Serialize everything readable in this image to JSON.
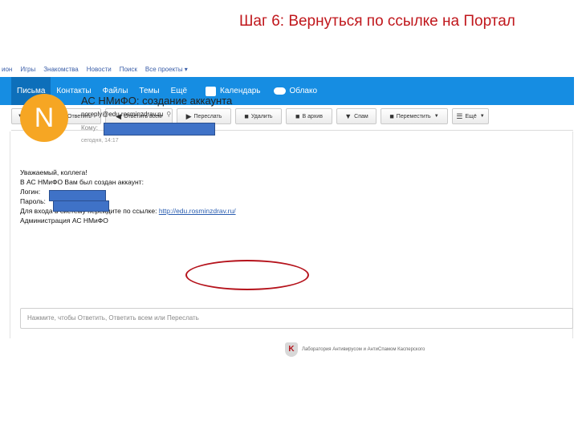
{
  "slide": {
    "title": "Шаг 6: Вернуться по ссылке на Портал"
  },
  "topnav": {
    "items": [
      "ион",
      "Игры",
      "Знакомства",
      "Новости",
      "Поиск",
      "Все проекты ▾"
    ]
  },
  "mainbar": {
    "tabs": [
      "Письма",
      "Контакты",
      "Файлы",
      "Темы",
      "Ещё"
    ],
    "active_tab": "Письма",
    "calendar_label": "Календарь",
    "cloud_label": "Облако",
    "color": "#168de2"
  },
  "toolbar": {
    "reply": "Ответить",
    "reply_all": "Ответить всем",
    "forward": "Переслать",
    "delete": "Удалить",
    "archive": "В архив",
    "spam": "Спам",
    "move": "Переместить",
    "more": "Ещё"
  },
  "message": {
    "avatar_letter": "N",
    "avatar_color": "#f6a623",
    "subject": "АС НМиФО: создание аккаунта",
    "from": "noreply@edu.rosminzdrav.ru",
    "to_label": "Кому:",
    "date": "сегодня, 14:17",
    "body": {
      "greeting": "Уважаемый, коллега!",
      "line_created": "В АС НМиФО Вам был создан аккаунт:",
      "login_label": "Логин:",
      "password_label": "Пароль:",
      "enter_prefix": "Для входа в систему перейдите по ссылке:",
      "link": "http://edu.rosminzdrav.ru/",
      "signature": "Администрация АС НМиФО"
    }
  },
  "reply_box": {
    "placeholder": "Нажмите, чтобы Ответить, Ответить всем или Переслать"
  },
  "footer": {
    "kaspersky_text": "Лаборатория Антивирусом и АнтиСпамом Касперского"
  },
  "annotation": {
    "circle_color": "#b5121b"
  }
}
